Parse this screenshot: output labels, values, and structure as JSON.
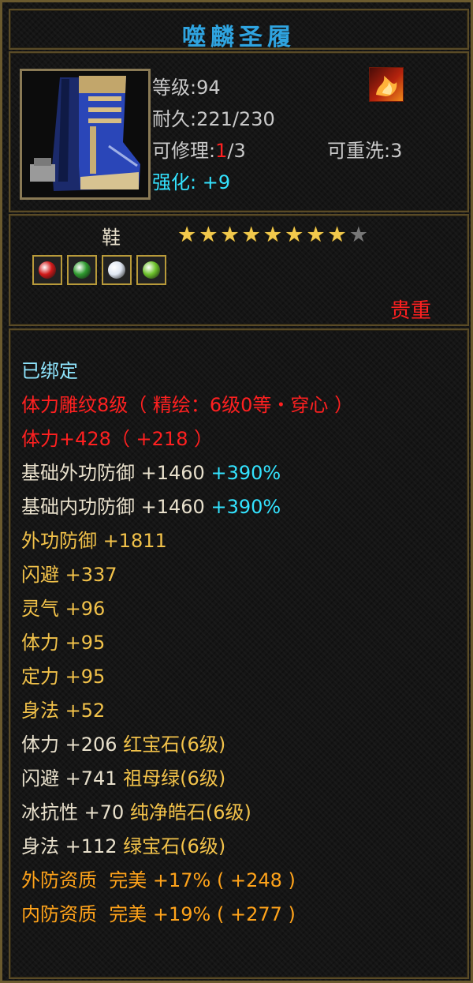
{
  "item": {
    "name": "噬麟圣履",
    "level_label": "等级",
    "level_value": "94",
    "durability_label": "耐久",
    "durability_value": "221/230",
    "repair_label": "可修理",
    "repair_current": "1",
    "repair_max": "/3",
    "rewash_label": "可重洗",
    "rewash_value": "3",
    "enhance_label": "强化",
    "enhance_value": "+9",
    "type": "鞋",
    "rarity": "贵重",
    "stars_filled": 8,
    "stars_total": 9
  },
  "gems": [
    {
      "name": "red-gem-icon",
      "color": "#d11919"
    },
    {
      "name": "green-gem-icon",
      "color": "#2e9a2e"
    },
    {
      "name": "white-gem-icon",
      "color": "#dfe6f2"
    },
    {
      "name": "lightgreen-gem-icon",
      "color": "#6cc12a"
    }
  ],
  "attributes": {
    "bound": "已绑定",
    "engrave": "体力雕纹8级（ 精绘：6级0等・穿心 ）",
    "stamina_bonus": "体力+428（ +218 ）",
    "base_ext_def_label": "基础外功防御 +1460",
    "base_ext_def_pct": "+390%",
    "base_int_def_label": "基础内功防御 +1460",
    "base_int_def_pct": "+390%",
    "ext_def": "外功防御 +1811",
    "dodge": "闪避 +337",
    "spirit": "灵气 +96",
    "stamina": "体力 +95",
    "focus": "定力 +95",
    "agility": "身法 +52",
    "gem_lines": [
      {
        "stat": "体力 +206",
        "gem": "红宝石(6级)"
      },
      {
        "stat": "闪避 +741",
        "gem": "祖母绿(6级)"
      },
      {
        "stat": "冰抗性 +70",
        "gem": "纯净皓石(6级)"
      },
      {
        "stat": "身法 +112",
        "gem": "绿宝石(6级)"
      }
    ],
    "ext_quality": "外防资质  完美 +17% ( +248 )",
    "int_quality": "内防资质  完美 +19% ( +277 )"
  }
}
